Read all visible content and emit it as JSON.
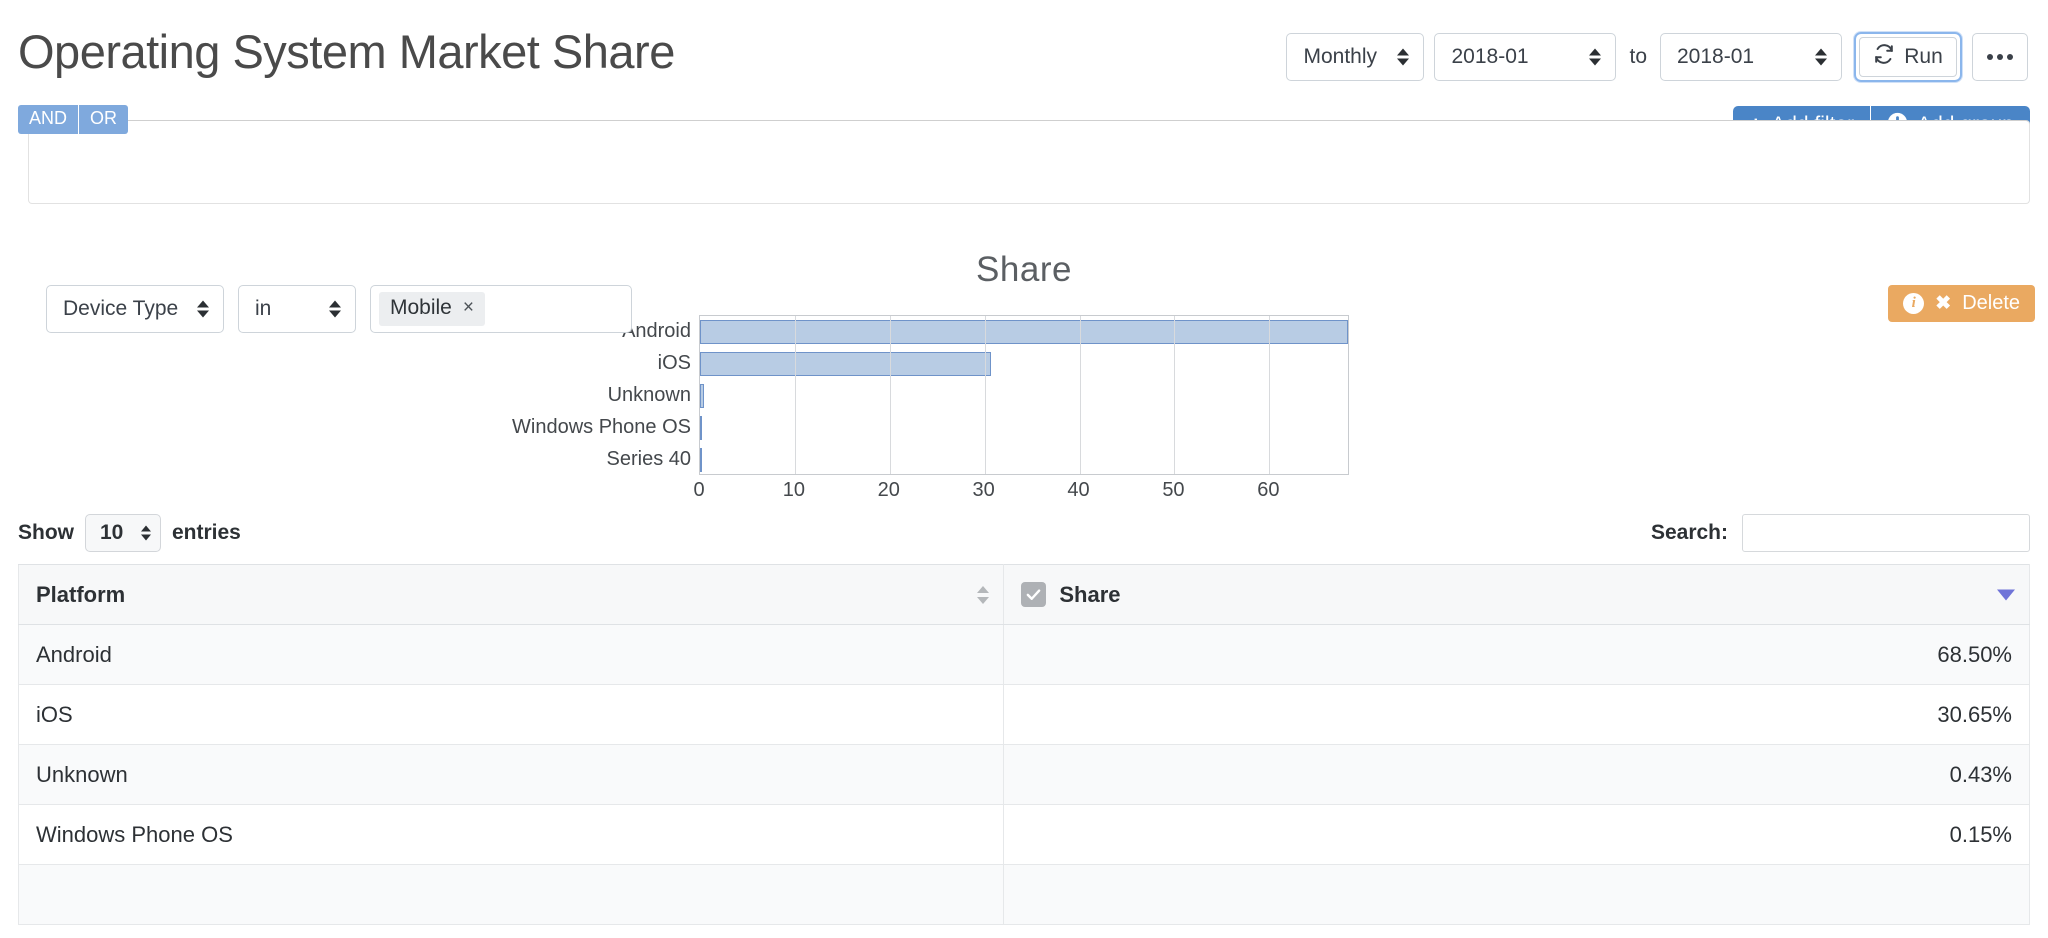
{
  "header": {
    "title": "Operating System Market Share",
    "period_select": {
      "value": "Monthly",
      "icon": "spinner-icon"
    },
    "date_from": {
      "value": "2018-01"
    },
    "to_label": "to",
    "date_to": {
      "value": "2018-01"
    },
    "run_button": {
      "label": "Run",
      "icon": "refresh-icon"
    },
    "overflow_button": {
      "icon": "ellipsis-icon"
    }
  },
  "filters": {
    "logic": {
      "and": "AND",
      "or": "OR",
      "active": "AND"
    },
    "add_filter_label": "Add filter",
    "add_group_label": "Add group",
    "delete_label": "Delete",
    "info_glyph": "i",
    "row": {
      "field": "Device Type",
      "operator": "in",
      "tags": [
        {
          "label": "Mobile",
          "remove": "×"
        }
      ]
    }
  },
  "chart_data": {
    "type": "bar",
    "orientation": "horizontal",
    "title": "Share",
    "xlabel": "",
    "ylabel": "",
    "categories": [
      "Android",
      "iOS",
      "Unknown",
      "Windows Phone OS",
      "Series 40"
    ],
    "values": [
      68.5,
      30.65,
      0.43,
      0.15,
      0.1
    ],
    "xticks": [
      0,
      10,
      20,
      30,
      40,
      50,
      60
    ],
    "xlim": [
      0,
      68.5
    ],
    "grid": true,
    "legend": false,
    "bar_fill": "#b8cce4",
    "bar_stroke": "#6f93c9"
  },
  "table": {
    "show_label": "Show",
    "entries_label": "entries",
    "page_length": "10",
    "search_label": "Search:",
    "search_value": "",
    "search_placeholder": "",
    "columns": [
      {
        "label": "Platform",
        "sort": "none"
      },
      {
        "label": "Share",
        "sort": "desc",
        "checkbox": true
      }
    ],
    "rows": [
      {
        "platform": "Android",
        "share": "68.50%"
      },
      {
        "platform": "iOS",
        "share": "30.65%"
      },
      {
        "platform": "Unknown",
        "share": "0.43%"
      },
      {
        "platform": "Windows Phone OS",
        "share": "0.15%"
      },
      {
        "platform": "",
        "share": ""
      }
    ]
  }
}
